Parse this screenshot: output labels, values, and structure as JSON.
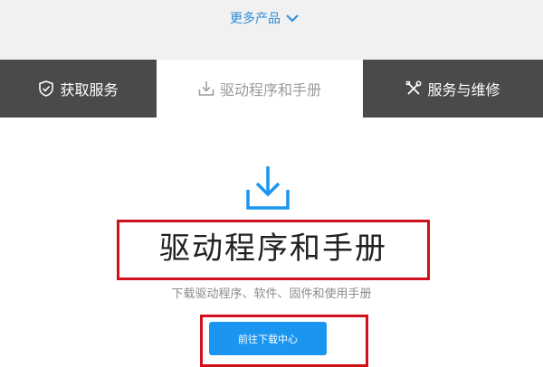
{
  "header": {
    "more_products_label": "更多产品",
    "more_products_icon": "chevron-down-icon",
    "accent_color": "#2b8cd8"
  },
  "tabs": [
    {
      "label": "获取服务",
      "icon": "shield-check-icon",
      "active": false
    },
    {
      "label": "驱动程序和手册",
      "icon": "download-icon",
      "active": true
    },
    {
      "label": "服务与维修",
      "icon": "tools-icon",
      "active": false
    }
  ],
  "main": {
    "icon": "download-icon",
    "title": "驱动程序和手册",
    "subtitle": "下载驱动程序、软件、固件和使用手册",
    "button_label": "前往下载中心",
    "button_color": "#1a96f0",
    "highlight_color": "#d0101b"
  }
}
